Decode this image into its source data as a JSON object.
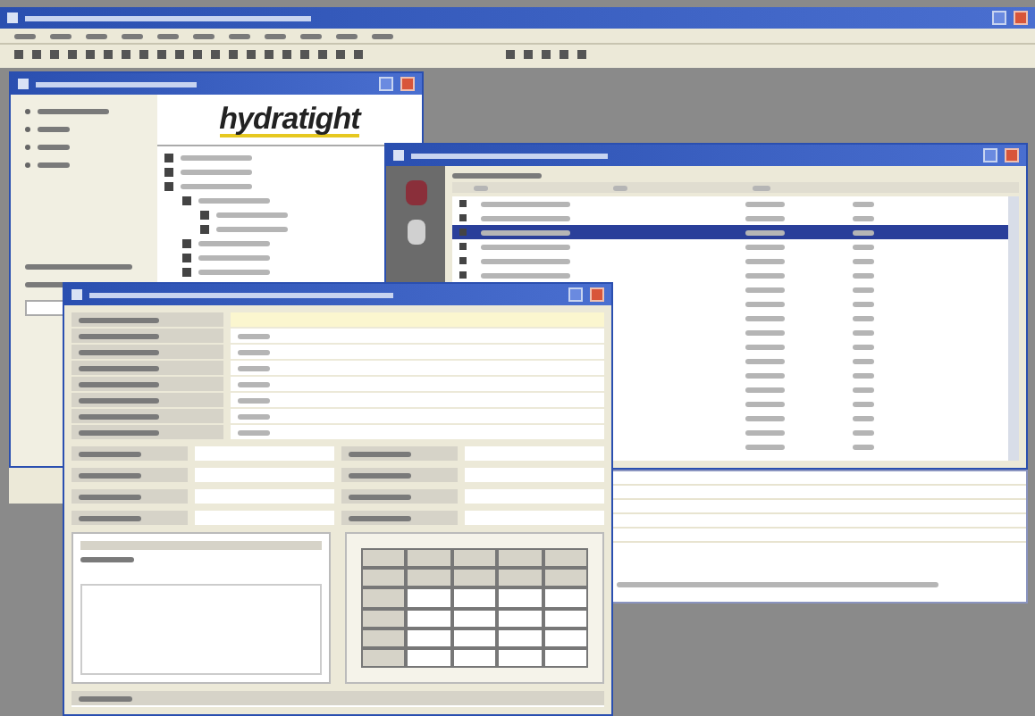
{
  "logo": {
    "text": "hydratight"
  },
  "work_list": {
    "rows": [
      {
        "selected": false
      },
      {
        "selected": false
      },
      {
        "selected": true
      },
      {
        "selected": false
      },
      {
        "selected": false
      },
      {
        "selected": false
      },
      {
        "selected": false
      },
      {
        "selected": false
      },
      {
        "selected": false
      },
      {
        "selected": false
      },
      {
        "selected": false
      },
      {
        "selected": false
      },
      {
        "selected": false
      },
      {
        "selected": false
      },
      {
        "selected": false
      },
      {
        "selected": false
      },
      {
        "selected": false
      },
      {
        "selected": false
      }
    ]
  }
}
